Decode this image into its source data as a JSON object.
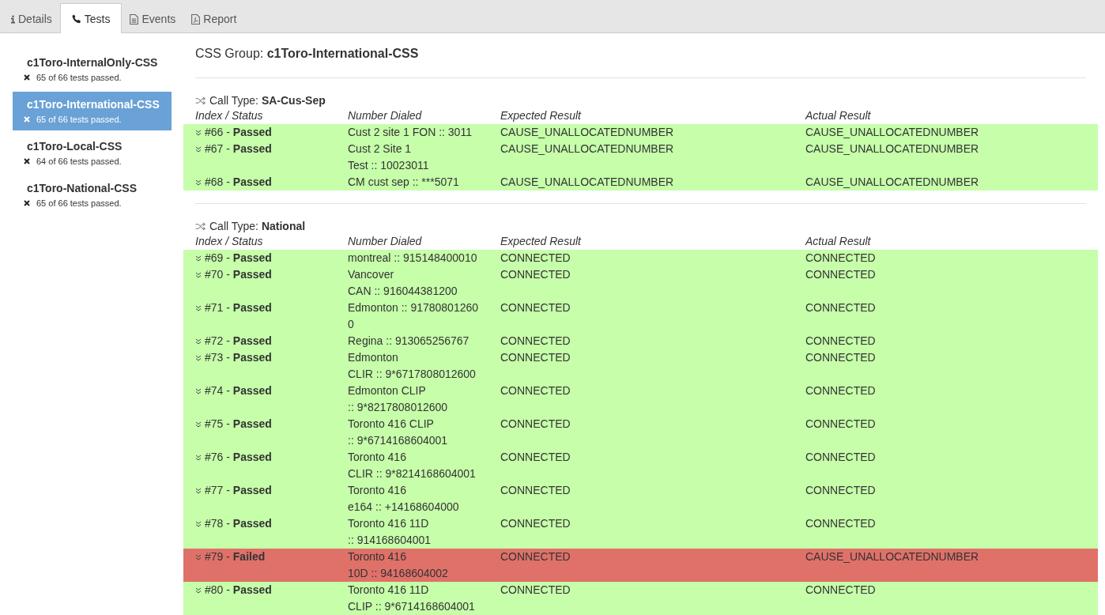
{
  "tabs": [
    {
      "label": "Details",
      "selected": false
    },
    {
      "label": "Tests",
      "selected": true
    },
    {
      "label": "Events",
      "selected": false
    },
    {
      "label": "Report",
      "selected": false
    }
  ],
  "sidebar": {
    "items": [
      {
        "title": "c1Toro-InternalOnly-CSS",
        "summary": "65 of 66 tests passed.",
        "selected": false
      },
      {
        "title": "c1Toro-International-CSS",
        "summary": "65 of 66 tests passed.",
        "selected": true
      },
      {
        "title": "c1Toro-Local-CSS",
        "summary": "64 of 66 tests passed.",
        "selected": false
      },
      {
        "title": "c1Toro-National-CSS",
        "summary": "65 of 66 tests passed.",
        "selected": false
      }
    ]
  },
  "group_title": "CSS Group: **c1Toro-International-CSS**",
  "sections": [
    {
      "title": "Call Type: **SA-Cus-Sep**",
      "columns": [
        "Index / Status",
        "Number Dialed",
        "Expected Result",
        "Actual Result"
      ],
      "rows": [
        {
          "status": "#66 - **Passed**",
          "failed": false,
          "dialed": [
            "Cust 2 site 1 FON :: 3011"
          ],
          "expected": "CAUSE_UNALLOCATEDNUMBER",
          "actual": "CAUSE_UNALLOCATEDNUMBER"
        },
        {
          "status": "#67 - **Passed**",
          "failed": false,
          "dialed": [
            "Cust 2 Site 1",
            "Test :: 10023011"
          ],
          "expected": "CAUSE_UNALLOCATEDNUMBER",
          "actual": "CAUSE_UNALLOCATEDNUMBER"
        },
        {
          "status": "#68 - **Passed**",
          "failed": false,
          "dialed": [
            "CM cust sep :: ***5071"
          ],
          "expected": "CAUSE_UNALLOCATEDNUMBER",
          "actual": "CAUSE_UNALLOCATEDNUMBER"
        }
      ]
    },
    {
      "title": "Call Type: **National**",
      "columns": [
        "Index / Status",
        "Number Dialed",
        "Expected Result",
        "Actual Result"
      ],
      "rows": [
        {
          "status": "#69 - **Passed**",
          "failed": false,
          "dialed": [
            "montreal :: 915148400010"
          ],
          "expected": "CONNECTED",
          "actual": "CONNECTED"
        },
        {
          "status": "#70 - **Passed**",
          "failed": false,
          "dialed": [
            "Vancover",
            "CAN :: 916044381200"
          ],
          "expected": "CONNECTED",
          "actual": "CONNECTED"
        },
        {
          "status": "#71 - **Passed**",
          "failed": false,
          "dialed": [
            "Edmonton :: 91780801260",
            "0"
          ],
          "expected": "CONNECTED",
          "actual": "CONNECTED"
        },
        {
          "status": "#72 - **Passed**",
          "failed": false,
          "dialed": [
            "Regina :: 913065256767"
          ],
          "expected": "CONNECTED",
          "actual": "CONNECTED"
        },
        {
          "status": "#73 - **Passed**",
          "failed": false,
          "dialed": [
            "Edmonton",
            "CLIR :: 9*6717808012600"
          ],
          "expected": "CONNECTED",
          "actual": "CONNECTED"
        },
        {
          "status": "#74 - **Passed**",
          "failed": false,
          "dialed": [
            "Edmonton CLIP",
            ":: 9*8217808012600"
          ],
          "expected": "CONNECTED",
          "actual": "CONNECTED"
        },
        {
          "status": "#75 - **Passed**",
          "failed": false,
          "dialed": [
            "Toronto 416 CLIP",
            ":: 9*6714168604001"
          ],
          "expected": "CONNECTED",
          "actual": "CONNECTED"
        },
        {
          "status": "#76 - **Passed**",
          "failed": false,
          "dialed": [
            "Toronto 416",
            "CLIR :: 9*8214168604001"
          ],
          "expected": "CONNECTED",
          "actual": "CONNECTED"
        },
        {
          "status": "#77 - **Passed**",
          "failed": false,
          "dialed": [
            "Toronto 416",
            "e164 :: +14168604000"
          ],
          "expected": "CONNECTED",
          "actual": "CONNECTED"
        },
        {
          "status": "#78 - **Passed**",
          "failed": false,
          "dialed": [
            "Toronto 416 11D",
            ":: 914168604001"
          ],
          "expected": "CONNECTED",
          "actual": "CONNECTED"
        },
        {
          "status": "#79 - **Failed**",
          "failed": true,
          "dialed": [
            "Toronto 416",
            "10D :: 94168604002"
          ],
          "expected": "CONNECTED",
          "actual": "CAUSE_UNALLOCATEDNUMBER"
        },
        {
          "status": "#80 - **Passed**",
          "failed": false,
          "dialed": [
            "Toronto 416 11D",
            "CLIP :: 9*6714168604001"
          ],
          "expected": "CONNECTED",
          "actual": "CONNECTED"
        }
      ]
    }
  ]
}
